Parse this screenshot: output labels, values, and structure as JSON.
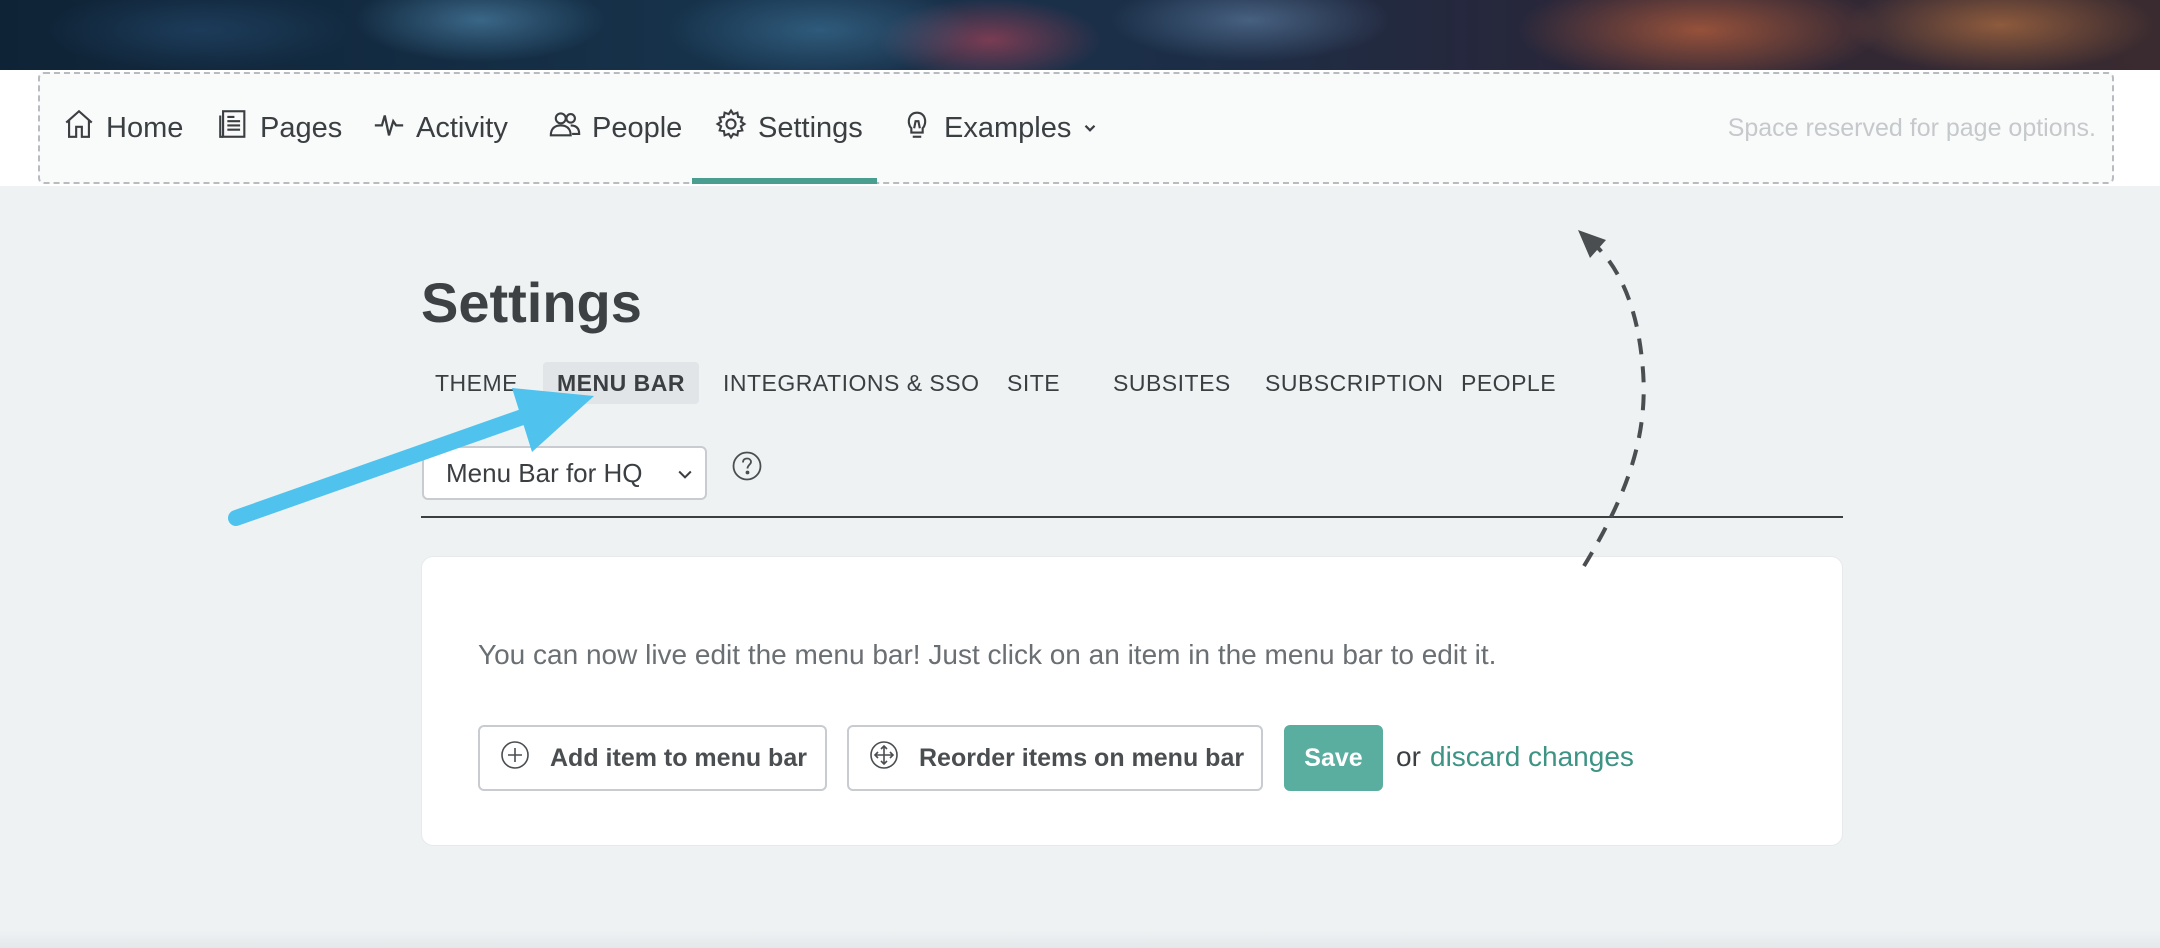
{
  "menubar": {
    "items": [
      {
        "label": "Home",
        "icon": "home-icon"
      },
      {
        "label": "Pages",
        "icon": "pages-icon"
      },
      {
        "label": "Activity",
        "icon": "activity-icon"
      },
      {
        "label": "People",
        "icon": "people-icon"
      },
      {
        "label": "Settings",
        "icon": "gear-icon",
        "active": true
      },
      {
        "label": "Examples",
        "icon": "lightbulb-icon",
        "dropdown": true
      }
    ],
    "page_options_text": "Space reserved for page options."
  },
  "page": {
    "title": "Settings",
    "tabs": [
      {
        "label": "THEME"
      },
      {
        "label": "MENU BAR",
        "active": true
      },
      {
        "label": "INTEGRATIONS & SSO"
      },
      {
        "label": "SITE"
      },
      {
        "label": "SUBSITES"
      },
      {
        "label": "SUBSCRIPTION"
      },
      {
        "label": "PEOPLE"
      }
    ],
    "select": {
      "value": "Menu Bar for HQ"
    }
  },
  "card": {
    "message": "You can now live edit the menu bar! Just click on an item in the menu bar to edit it.",
    "add_button": "Add item to menu bar",
    "reorder_button": "Reorder items on menu bar",
    "save_button": "Save",
    "or_text": "or",
    "discard_link": "discard changes"
  },
  "colors": {
    "accent": "#4a9e90",
    "save": "#5aaea0",
    "annotation_arrow": "#4fc3ee",
    "dashed_arrow": "#4a4e51"
  }
}
